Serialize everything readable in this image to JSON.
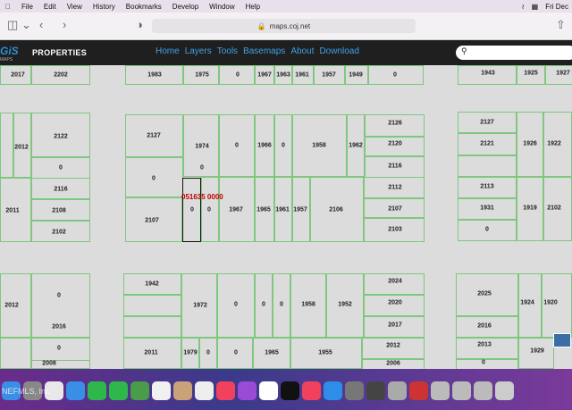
{
  "menubar": {
    "items": [
      "File",
      "Edit",
      "View",
      "History",
      "Bookmarks",
      "Develop",
      "Window",
      "Help"
    ],
    "clock": "Fri Dec"
  },
  "toolbar": {
    "url": "maps.coj.net"
  },
  "navbar": {
    "logo": "GiS",
    "logo_sub": "MAPS",
    "brand": "PROPERTIES",
    "links": [
      "Home",
      "Layers",
      "Tools",
      "Basemaps",
      "About",
      "Download"
    ]
  },
  "map": {
    "selected_parcel_label": "051635 0000",
    "parcel_numbers": [
      "2017",
      "2202",
      "1983",
      "1975",
      "0",
      "1967",
      "1963",
      "1961",
      "1957",
      "1949",
      "0",
      "1943",
      "1925",
      "1927",
      "2126",
      "2127",
      "1974",
      "0",
      "1966",
      "0",
      "1958",
      "1962",
      "2120",
      "2127",
      "2012",
      "2122",
      "0",
      "2116",
      "2121",
      "1926",
      "1922",
      "0",
      "2116",
      "0",
      "2112",
      "2113",
      "2011",
      "2108",
      "2107",
      "0",
      "0",
      "1967",
      "1965",
      "1961",
      "1957",
      "2106",
      "2107",
      "1931",
      "1919",
      "2102",
      "2102",
      "2103",
      "0",
      "1942",
      "2024",
      "0",
      "1972",
      "0",
      "0",
      "0",
      "1958",
      "1952",
      "2020",
      "2025",
      "2012",
      "1924",
      "1920",
      "2016",
      "2017",
      "2016",
      "0",
      "2011",
      "1979",
      "0",
      "0",
      "1965",
      "1955",
      "2012",
      "2013",
      "1929",
      "0",
      "2008",
      "2006",
      "0"
    ]
  },
  "watermark": "NEFMLS, Inc.",
  "colors": {
    "parcel_border": "#7fc77f",
    "selected_label": "#c00000",
    "nav_link": "#3fa0e6"
  }
}
